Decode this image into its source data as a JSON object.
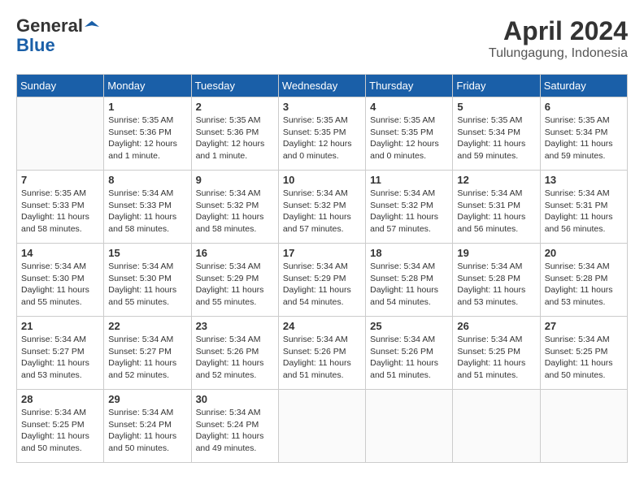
{
  "header": {
    "logo_general": "General",
    "logo_blue": "Blue",
    "month_year": "April 2024",
    "location": "Tulungagung, Indonesia"
  },
  "days_of_week": [
    "Sunday",
    "Monday",
    "Tuesday",
    "Wednesday",
    "Thursday",
    "Friday",
    "Saturday"
  ],
  "weeks": [
    [
      {
        "day": "",
        "info": ""
      },
      {
        "day": "1",
        "info": "Sunrise: 5:35 AM\nSunset: 5:36 PM\nDaylight: 12 hours\nand 1 minute."
      },
      {
        "day": "2",
        "info": "Sunrise: 5:35 AM\nSunset: 5:36 PM\nDaylight: 12 hours\nand 1 minute."
      },
      {
        "day": "3",
        "info": "Sunrise: 5:35 AM\nSunset: 5:35 PM\nDaylight: 12 hours\nand 0 minutes."
      },
      {
        "day": "4",
        "info": "Sunrise: 5:35 AM\nSunset: 5:35 PM\nDaylight: 12 hours\nand 0 minutes."
      },
      {
        "day": "5",
        "info": "Sunrise: 5:35 AM\nSunset: 5:34 PM\nDaylight: 11 hours\nand 59 minutes."
      },
      {
        "day": "6",
        "info": "Sunrise: 5:35 AM\nSunset: 5:34 PM\nDaylight: 11 hours\nand 59 minutes."
      }
    ],
    [
      {
        "day": "7",
        "info": "Sunrise: 5:35 AM\nSunset: 5:33 PM\nDaylight: 11 hours\nand 58 minutes."
      },
      {
        "day": "8",
        "info": "Sunrise: 5:34 AM\nSunset: 5:33 PM\nDaylight: 11 hours\nand 58 minutes."
      },
      {
        "day": "9",
        "info": "Sunrise: 5:34 AM\nSunset: 5:32 PM\nDaylight: 11 hours\nand 58 minutes."
      },
      {
        "day": "10",
        "info": "Sunrise: 5:34 AM\nSunset: 5:32 PM\nDaylight: 11 hours\nand 57 minutes."
      },
      {
        "day": "11",
        "info": "Sunrise: 5:34 AM\nSunset: 5:32 PM\nDaylight: 11 hours\nand 57 minutes."
      },
      {
        "day": "12",
        "info": "Sunrise: 5:34 AM\nSunset: 5:31 PM\nDaylight: 11 hours\nand 56 minutes."
      },
      {
        "day": "13",
        "info": "Sunrise: 5:34 AM\nSunset: 5:31 PM\nDaylight: 11 hours\nand 56 minutes."
      }
    ],
    [
      {
        "day": "14",
        "info": "Sunrise: 5:34 AM\nSunset: 5:30 PM\nDaylight: 11 hours\nand 55 minutes."
      },
      {
        "day": "15",
        "info": "Sunrise: 5:34 AM\nSunset: 5:30 PM\nDaylight: 11 hours\nand 55 minutes."
      },
      {
        "day": "16",
        "info": "Sunrise: 5:34 AM\nSunset: 5:29 PM\nDaylight: 11 hours\nand 55 minutes."
      },
      {
        "day": "17",
        "info": "Sunrise: 5:34 AM\nSunset: 5:29 PM\nDaylight: 11 hours\nand 54 minutes."
      },
      {
        "day": "18",
        "info": "Sunrise: 5:34 AM\nSunset: 5:28 PM\nDaylight: 11 hours\nand 54 minutes."
      },
      {
        "day": "19",
        "info": "Sunrise: 5:34 AM\nSunset: 5:28 PM\nDaylight: 11 hours\nand 53 minutes."
      },
      {
        "day": "20",
        "info": "Sunrise: 5:34 AM\nSunset: 5:28 PM\nDaylight: 11 hours\nand 53 minutes."
      }
    ],
    [
      {
        "day": "21",
        "info": "Sunrise: 5:34 AM\nSunset: 5:27 PM\nDaylight: 11 hours\nand 53 minutes."
      },
      {
        "day": "22",
        "info": "Sunrise: 5:34 AM\nSunset: 5:27 PM\nDaylight: 11 hours\nand 52 minutes."
      },
      {
        "day": "23",
        "info": "Sunrise: 5:34 AM\nSunset: 5:26 PM\nDaylight: 11 hours\nand 52 minutes."
      },
      {
        "day": "24",
        "info": "Sunrise: 5:34 AM\nSunset: 5:26 PM\nDaylight: 11 hours\nand 51 minutes."
      },
      {
        "day": "25",
        "info": "Sunrise: 5:34 AM\nSunset: 5:26 PM\nDaylight: 11 hours\nand 51 minutes."
      },
      {
        "day": "26",
        "info": "Sunrise: 5:34 AM\nSunset: 5:25 PM\nDaylight: 11 hours\nand 51 minutes."
      },
      {
        "day": "27",
        "info": "Sunrise: 5:34 AM\nSunset: 5:25 PM\nDaylight: 11 hours\nand 50 minutes."
      }
    ],
    [
      {
        "day": "28",
        "info": "Sunrise: 5:34 AM\nSunset: 5:25 PM\nDaylight: 11 hours\nand 50 minutes."
      },
      {
        "day": "29",
        "info": "Sunrise: 5:34 AM\nSunset: 5:24 PM\nDaylight: 11 hours\nand 50 minutes."
      },
      {
        "day": "30",
        "info": "Sunrise: 5:34 AM\nSunset: 5:24 PM\nDaylight: 11 hours\nand 49 minutes."
      },
      {
        "day": "",
        "info": ""
      },
      {
        "day": "",
        "info": ""
      },
      {
        "day": "",
        "info": ""
      },
      {
        "day": "",
        "info": ""
      }
    ]
  ]
}
